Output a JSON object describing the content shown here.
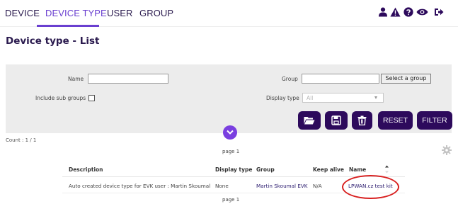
{
  "nav": {
    "tabs": [
      {
        "label": "DEVICE"
      },
      {
        "label": "DEVICE TYPE"
      },
      {
        "label": "USER"
      },
      {
        "label": "GROUP"
      }
    ],
    "active_tab": "DEVICE TYPE",
    "icons": [
      "users-icon",
      "warning-icon",
      "help-icon",
      "eye-icon",
      "logout-icon"
    ]
  },
  "page": {
    "title": "Device type - List"
  },
  "filter": {
    "name_label": "Name",
    "name_value": "",
    "group_label": "Group",
    "group_value": "",
    "select_group_label": "Select a group",
    "include_subgroups_label": "Include sub groups",
    "include_subgroups_checked": false,
    "display_type_label": "Display type",
    "display_type_value": "All",
    "buttons": {
      "open_icon": "folder-open-icon",
      "save_icon": "save-icon",
      "delete_icon": "trash-icon",
      "reset_label": "RESET",
      "filter_label": "FILTER"
    },
    "collapse_icon": "chevron-down-icon"
  },
  "results": {
    "count": "Count : 1 / 1",
    "page_top": "page 1",
    "page_bottom": "page 1",
    "columns": [
      "Description",
      "Display type",
      "Group",
      "Keep alive",
      "Name"
    ],
    "rows": [
      {
        "description": "Auto created device type for EVK user : Martin Skoumal",
        "display_type": "None",
        "group": "Martin Skoumal EVK",
        "keep_alive": "N/A",
        "name": "LPWAN.cz test kit"
      }
    ]
  },
  "colors": {
    "primary": "#2d0a5c",
    "accent": "#6a3fd0",
    "highlight": "#d82020"
  }
}
